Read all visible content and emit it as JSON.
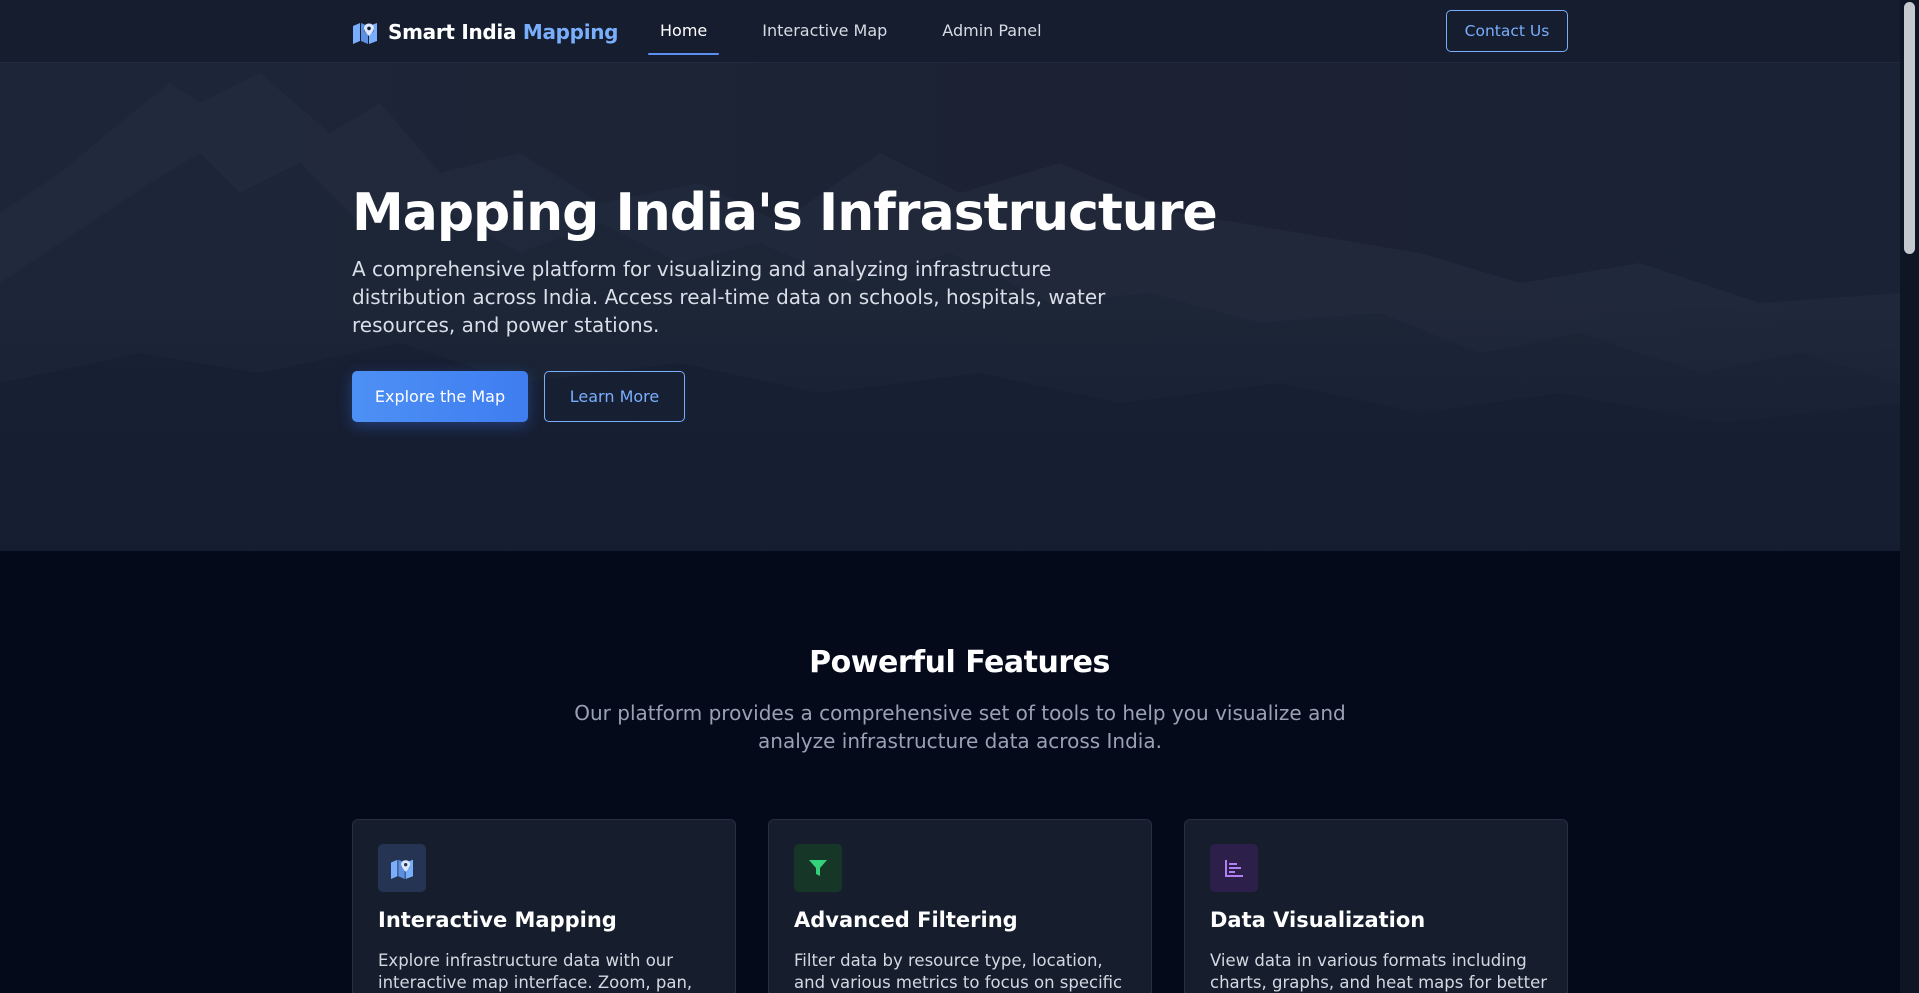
{
  "header": {
    "brand_part1": "Smart India",
    "brand_part2": "Mapping",
    "brand_icon": "map-marker-icon",
    "nav": [
      {
        "label": "Home",
        "active": true
      },
      {
        "label": "Interactive Map",
        "active": false
      },
      {
        "label": "Admin Panel",
        "active": false
      }
    ],
    "contact_label": "Contact Us"
  },
  "hero": {
    "title": "Mapping India's Infrastructure",
    "description": "A comprehensive platform for visualizing and analyzing infrastructure distribution across India. Access real-time data on schools, hospitals, water resources, and power stations.",
    "primary_button": "Explore the Map",
    "secondary_button": "Learn More"
  },
  "features": {
    "title": "Powerful Features",
    "subtitle": "Our platform provides a comprehensive set of tools to help you visualize and analyze infrastructure data across India.",
    "cards": [
      {
        "icon": "map-marker-icon",
        "icon_color": "#79aefc",
        "icon_bg": "#253453",
        "title": "Interactive Mapping",
        "text": "Explore infrastructure data with our interactive map interface. Zoom, pan,"
      },
      {
        "icon": "filter-icon",
        "icon_color": "#34d27b",
        "icon_bg": "#163727",
        "title": "Advanced Filtering",
        "text": "Filter data by resource type, location, and various metrics to focus on specific"
      },
      {
        "icon": "bar-chart-icon",
        "icon_color": "#b27ff5",
        "icon_bg": "#2c1f4a",
        "title": "Data Visualization",
        "text": "View data in various formats including charts, graphs, and heat maps for better"
      }
    ]
  },
  "colors": {
    "accent": "#79aefc",
    "primary": "#4d90f5",
    "background": "#050a1b",
    "header_bg": "#151d2e"
  }
}
